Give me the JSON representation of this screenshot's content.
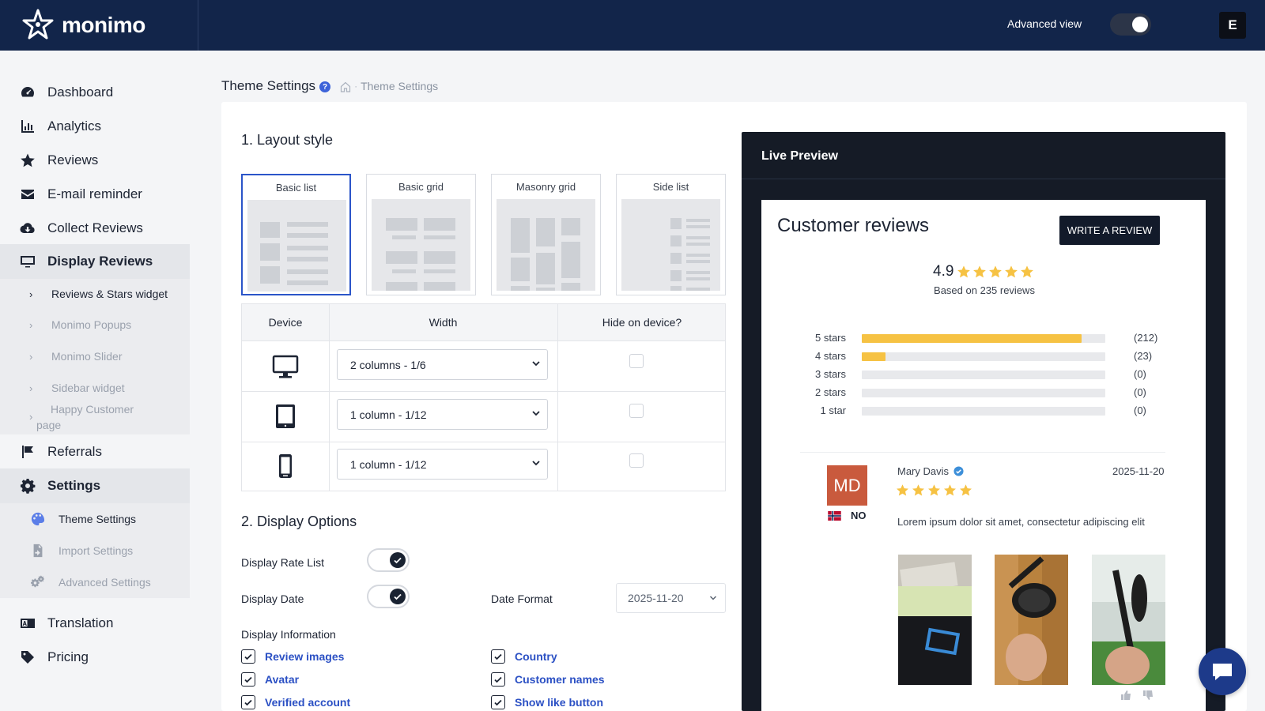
{
  "header": {
    "brand": "monimo",
    "advanced_view_label": "Advanced view",
    "advanced_view_on": true,
    "user_initial": "E"
  },
  "sidebar": {
    "items": [
      {
        "label": "Dashboard",
        "icon": "dashboard-icon"
      },
      {
        "label": "Analytics",
        "icon": "bar-chart-icon"
      },
      {
        "label": "Reviews",
        "icon": "star-icon"
      },
      {
        "label": "E-mail reminder",
        "icon": "envelope-icon"
      },
      {
        "label": "Collect Reviews",
        "icon": "cloud-download-icon"
      },
      {
        "label": "Display Reviews",
        "icon": "monitor-icon",
        "active": true
      },
      {
        "label": "Referrals",
        "icon": "flag-icon"
      },
      {
        "label": "Settings",
        "icon": "gear-icon",
        "active": true
      },
      {
        "label": "Translation",
        "icon": "translate-icon"
      },
      {
        "label": "Pricing",
        "icon": "tag-icon"
      }
    ],
    "display_sub": [
      {
        "label": "Reviews & Stars widget",
        "current": true
      },
      {
        "label": "Monimo Popups"
      },
      {
        "label": "Monimo Slider"
      },
      {
        "label": "Sidebar widget"
      },
      {
        "label_line1": "Happy Customer",
        "label_line2": "page"
      }
    ],
    "settings_sub": [
      {
        "label": "Theme Settings",
        "icon": "palette-icon",
        "current": true
      },
      {
        "label": "Import Settings",
        "icon": "file-import-icon"
      },
      {
        "label": "Advanced Settings",
        "icon": "gears-icon"
      }
    ]
  },
  "breadcrumb": {
    "title": "Theme Settings",
    "help": "?",
    "current": "Theme Settings"
  },
  "layout_section": {
    "title": "1. Layout style",
    "options": [
      {
        "label": "Basic list",
        "selected": true
      },
      {
        "label": "Basic grid"
      },
      {
        "label": "Masonry grid"
      },
      {
        "label": "Side list"
      }
    ]
  },
  "device_table": {
    "headers": [
      "Device",
      "Width",
      "Hide on device?"
    ],
    "rows": [
      {
        "device": "desktop-icon",
        "width": "2 columns - 1/6",
        "hide": false
      },
      {
        "device": "tablet-icon",
        "width": "1 column - 1/12",
        "hide": false
      },
      {
        "device": "mobile-icon",
        "width": "1 column - 1/12",
        "hide": false
      }
    ]
  },
  "display_options": {
    "title": "2. Display Options",
    "rate_list_label": "Display Rate List",
    "rate_list_on": true,
    "date_label": "Display Date",
    "date_on": true,
    "date_format_label": "Date Format",
    "date_format_value": "2025-11-20",
    "info_label": "Display Information",
    "checks": [
      {
        "label": "Review images",
        "checked": true
      },
      {
        "label": "Country",
        "checked": true
      },
      {
        "label": "Avatar",
        "checked": true
      },
      {
        "label": "Customer names",
        "checked": true
      },
      {
        "label": "Verified account",
        "checked": true
      },
      {
        "label": "Show like button",
        "checked": true
      }
    ]
  },
  "preview": {
    "title": "Live Preview",
    "heading": "Customer reviews",
    "write_button": "WRITE A REVIEW",
    "average": "4.9",
    "based_on": "Based on 235 reviews",
    "distribution": [
      {
        "label": "5 stars",
        "count": "(212)",
        "fraction": 0.902
      },
      {
        "label": "4 stars",
        "count": "(23)",
        "fraction": 0.098
      },
      {
        "label": "3 stars",
        "count": "(0)",
        "fraction": 0
      },
      {
        "label": "2 stars",
        "count": "(0)",
        "fraction": 0
      },
      {
        "label": "1 star",
        "count": "(0)",
        "fraction": 0
      }
    ],
    "review": {
      "initials": "MD",
      "country": "NO",
      "name": "Mary Davis",
      "date": "2025-11-20",
      "rating": 5,
      "text": "Lorem ipsum dolor sit amet, consectetur adipiscing elit"
    }
  },
  "colors": {
    "topbar": "#12254a",
    "accent": "#2b55c9",
    "star": "#f6c243",
    "avatar": "#c95a3d"
  }
}
